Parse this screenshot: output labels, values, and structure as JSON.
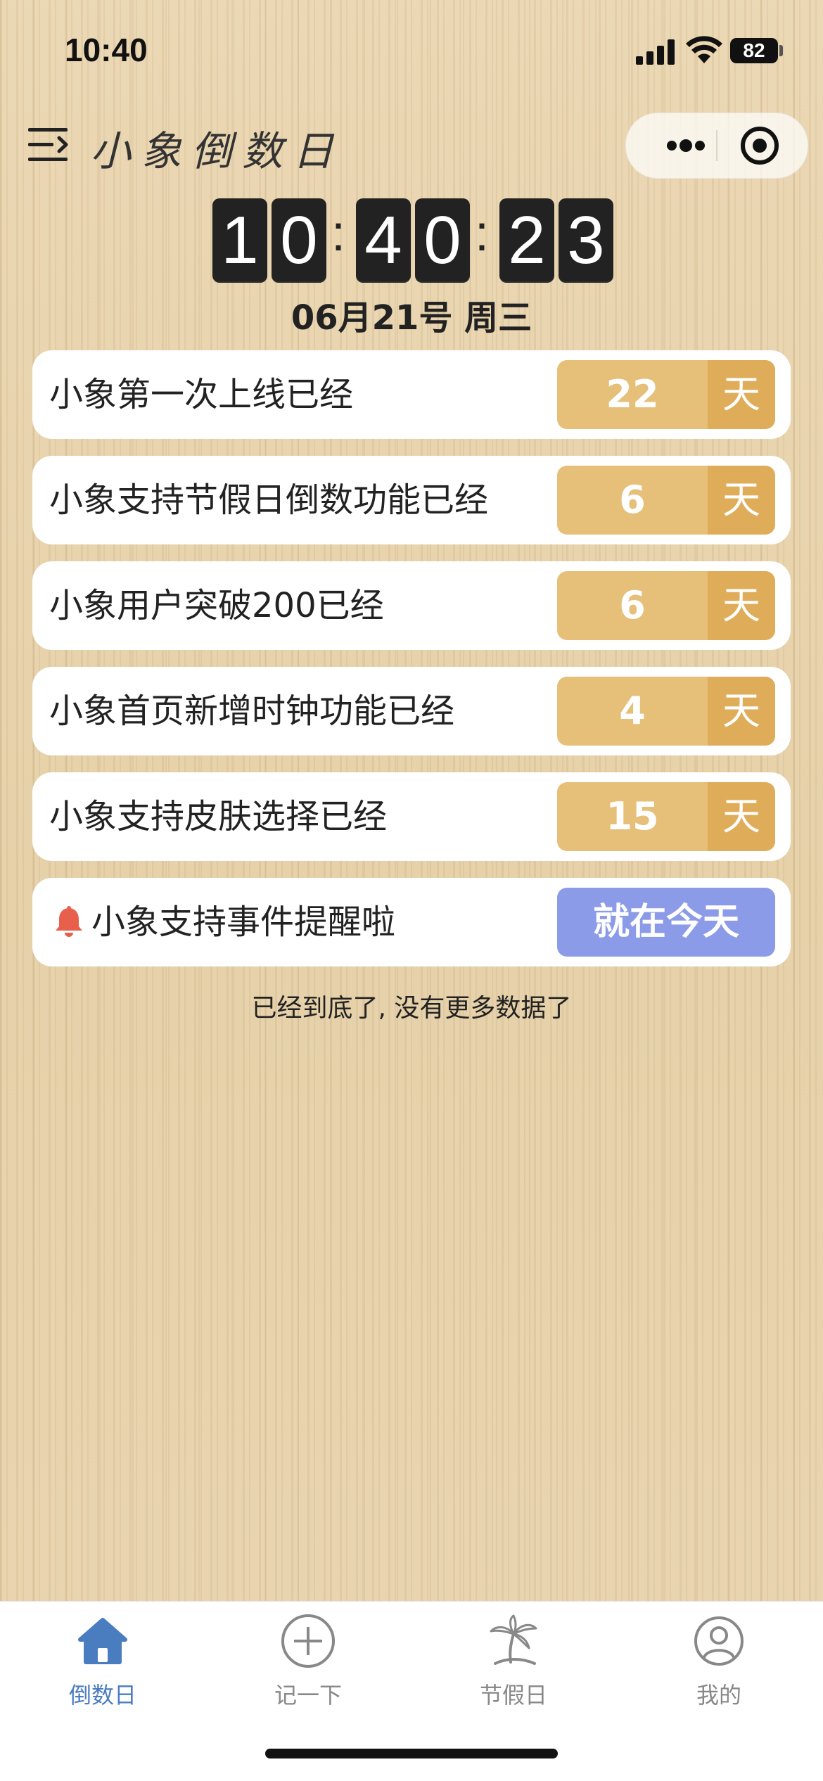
{
  "status_bar": {
    "time": "10:40",
    "battery": "82"
  },
  "nav": {
    "title": "小象倒数日"
  },
  "clock": {
    "digits": [
      "1",
      "0",
      "4",
      "0",
      "2",
      "3"
    ],
    "separator": ":",
    "date": "06月21号 周三"
  },
  "events": [
    {
      "label": "小象第一次上线已经",
      "count": "22",
      "unit": "天"
    },
    {
      "label": "小象支持节假日倒数功能已经",
      "count": "6",
      "unit": "天"
    },
    {
      "label": "小象用户突破200已经",
      "count": "6",
      "unit": "天"
    },
    {
      "label": "小象首页新增时钟功能已经",
      "count": "4",
      "unit": "天"
    },
    {
      "label": "小象支持皮肤选择已经",
      "count": "15",
      "unit": "天"
    }
  ],
  "reminder": {
    "label": "小象支持事件提醒啦",
    "badge": "就在今天",
    "icon": "bell-icon"
  },
  "end_note": "已经到底了, 没有更多数据了",
  "tabs": [
    {
      "label": "倒数日",
      "icon": "home-icon",
      "active": true
    },
    {
      "label": "记一下",
      "icon": "plus-circle-icon",
      "active": false
    },
    {
      "label": "节假日",
      "icon": "palm-tree-icon",
      "active": false
    },
    {
      "label": "我的",
      "icon": "user-icon",
      "active": false
    }
  ],
  "colors": {
    "accent_gold": "#e6bf79",
    "accent_gold_dark": "#dfad5a",
    "today_purple": "#8c9be8",
    "tab_active": "#4a7cc0",
    "bell_red": "#e8604c"
  }
}
